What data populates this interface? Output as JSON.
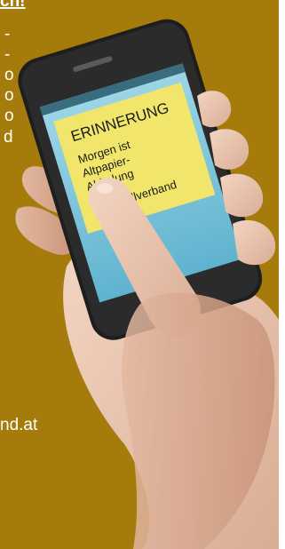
{
  "left_text": {
    "heading_fragment": "ch!",
    "line_1": "-",
    "line_2": "-",
    "line_3": "o",
    "line_4": "o",
    "line_5": "o",
    "line_6": "d",
    "footer_fragment": "nd.at"
  },
  "phone_notification": {
    "title": "ERINNERUNG",
    "line_1": "Morgen ist",
    "line_2": "Altpapier-",
    "line_3": "Abholung",
    "line_4": "Ihr Abfallverband"
  },
  "colors": {
    "background": "#a57c0c",
    "note_yellow": "#f1e66b",
    "screen_blue": "#7cc6dd",
    "phone_body": "#1e1e1e"
  }
}
